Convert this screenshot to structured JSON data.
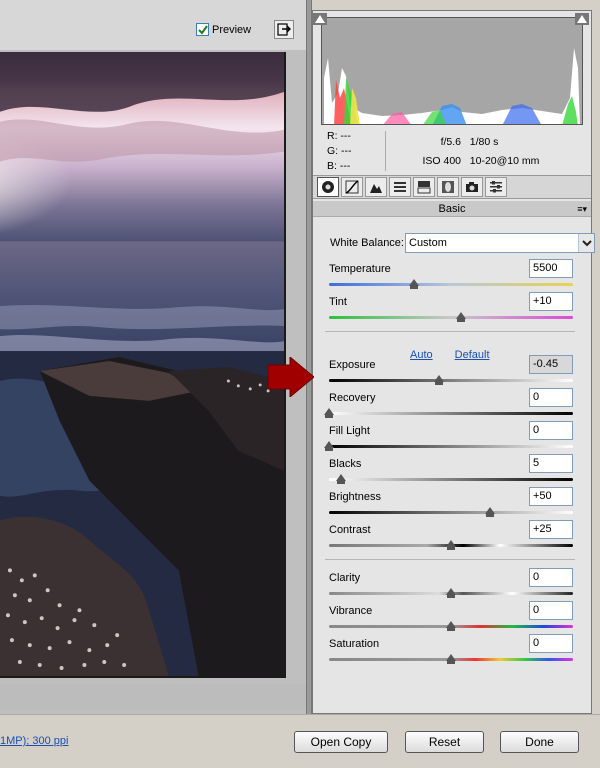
{
  "preview": {
    "label": "Preview",
    "checked": true
  },
  "camera_info": {
    "r_label": "R:",
    "g_label": "G:",
    "b_label": "B:",
    "r_value": "---",
    "g_value": "---",
    "b_value": "---",
    "aperture": "f/5.6",
    "shutter": "1/80 s",
    "iso": "ISO 400",
    "lens": "10-20@10 mm"
  },
  "panel": {
    "section_title": "Basic"
  },
  "white_balance": {
    "label": "White Balance:",
    "value": "Custom"
  },
  "sliders": {
    "temperature": {
      "label": "Temperature",
      "value": "5500",
      "fraction": 0.35
    },
    "tint": {
      "label": "Tint",
      "value": "+10",
      "fraction": 0.54
    },
    "exposure": {
      "label": "Exposure",
      "value": "-0.45",
      "fraction": 0.45
    },
    "recovery": {
      "label": "Recovery",
      "value": "0",
      "fraction": 0.0
    },
    "fill_light": {
      "label": "Fill Light",
      "value": "0",
      "fraction": 0.0
    },
    "blacks": {
      "label": "Blacks",
      "value": "5",
      "fraction": 0.05
    },
    "brightness": {
      "label": "Brightness",
      "value": "+50",
      "fraction": 0.66
    },
    "contrast": {
      "label": "Contrast",
      "value": "+25",
      "fraction": 0.5
    },
    "clarity": {
      "label": "Clarity",
      "value": "0",
      "fraction": 0.5
    },
    "vibrance": {
      "label": "Vibrance",
      "value": "0",
      "fraction": 0.5
    },
    "saturation": {
      "label": "Saturation",
      "value": "0",
      "fraction": 0.5
    }
  },
  "links": {
    "auto": "Auto",
    "default": "Default"
  },
  "bottom": {
    "info_link": "1MP); 300 ppi",
    "open_copy": "Open Copy",
    "reset": "Reset",
    "done": "Done"
  },
  "colors": {
    "accent_red": "#a00000",
    "link": "#1a4fb3"
  }
}
